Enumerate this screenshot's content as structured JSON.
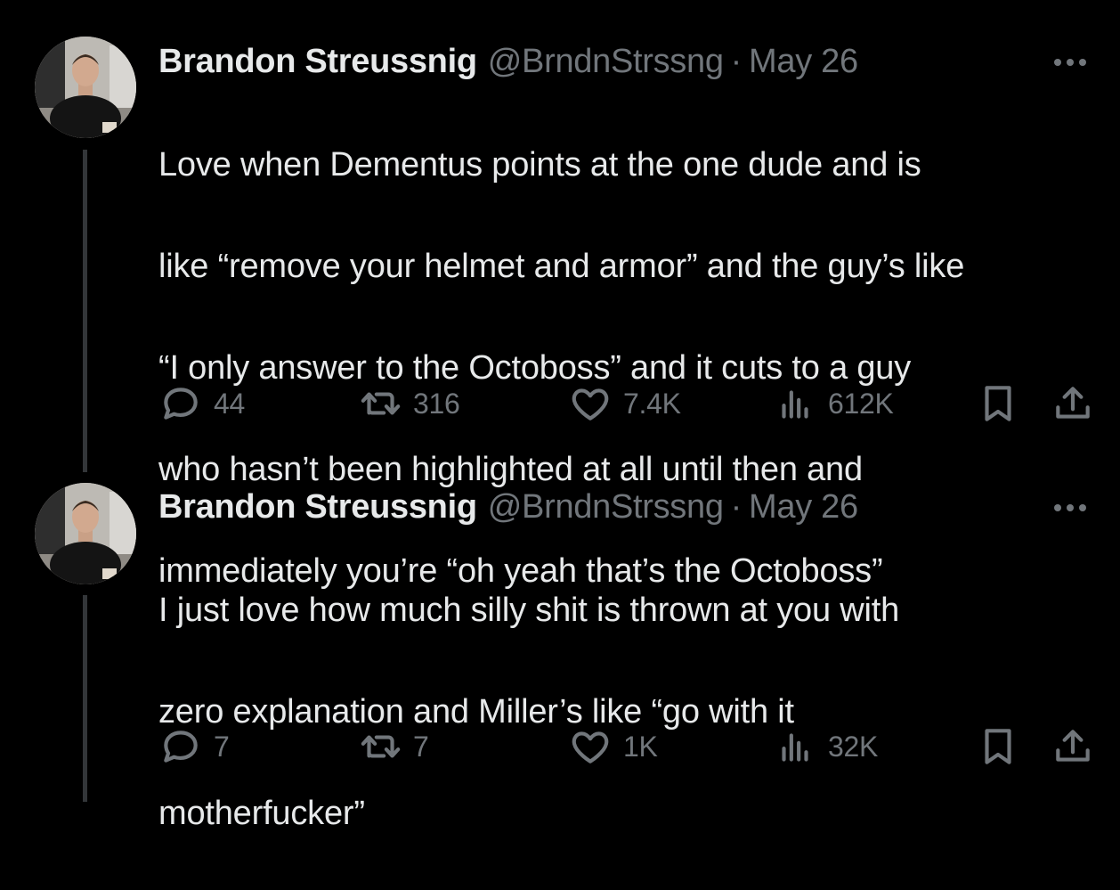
{
  "tweets": [
    {
      "author": {
        "display_name": "Brandon Streussnig",
        "handle": "@BrndnStrssng"
      },
      "separator": "·",
      "date": "May 26",
      "lines": [
        "Love when Dementus points at the one dude and is",
        "like “remove your helmet and armor” and the guy’s like",
        "“I only answer to the Octoboss” and it cuts to a guy",
        "who hasn’t been highlighted at all until then and",
        "immediately you’re “oh yeah that’s the Octoboss”"
      ],
      "stats": {
        "replies": "44",
        "retweets": "316",
        "likes": "7.4K",
        "views": "612K"
      }
    },
    {
      "author": {
        "display_name": "Brandon Streussnig",
        "handle": "@BrndnStrssng"
      },
      "separator": "·",
      "date": "May 26",
      "lines": [
        "I just love how much silly shit is thrown at you with",
        "zero explanation and Miller’s like “go with it",
        "motherfucker”"
      ],
      "stats": {
        "replies": "7",
        "retweets": "7",
        "likes": "1K",
        "views": "32K"
      }
    }
  ],
  "icons": {
    "more": "more-horizontal-icon",
    "reply": "reply-bubble-icon",
    "retweet": "retweet-arrows-icon",
    "like": "heart-icon",
    "views": "bar-chart-icon",
    "bookmark": "bookmark-icon",
    "share": "share-upload-icon"
  },
  "colors": {
    "background": "#000000",
    "text_primary": "#e7e9ea",
    "text_secondary": "#71767b",
    "thread_line": "#333639"
  }
}
